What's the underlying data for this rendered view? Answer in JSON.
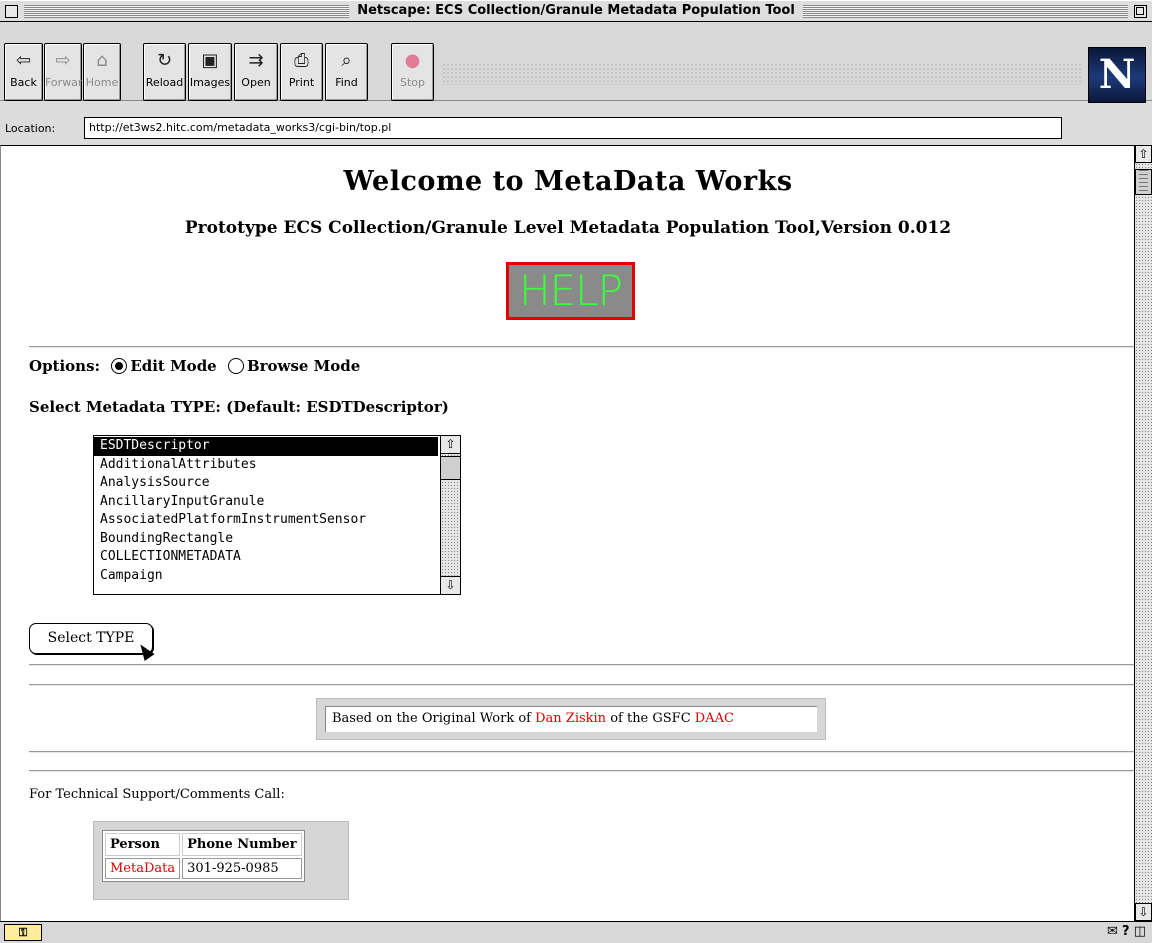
{
  "window": {
    "title": "Netscape: ECS Collection/Granule Metadata Population Tool"
  },
  "toolbar": {
    "buttons": [
      {
        "label": "Back",
        "icon": "back-arrow-icon",
        "glyph": "⇦"
      },
      {
        "label": "Forward",
        "icon": "forward-arrow-icon",
        "glyph": "⇨"
      },
      {
        "label": "Home",
        "icon": "home-icon",
        "glyph": "⌂"
      },
      {
        "label": "Reload",
        "icon": "reload-icon",
        "glyph": "↻"
      },
      {
        "label": "Images",
        "icon": "images-icon",
        "glyph": "▣"
      },
      {
        "label": "Open",
        "icon": "open-icon",
        "glyph": "⇉"
      },
      {
        "label": "Print",
        "icon": "print-icon",
        "glyph": "⎙"
      },
      {
        "label": "Find",
        "icon": "find-icon",
        "glyph": "⌕"
      },
      {
        "label": "Stop",
        "icon": "stop-icon",
        "glyph": "●"
      }
    ],
    "logo_letter": "N"
  },
  "location": {
    "label": "Location:",
    "url": "http://et3ws2.hitc.com/metadata_works3/cgi-bin/top.pl"
  },
  "page": {
    "heading": "Welcome to MetaData Works",
    "subheading": "Prototype ECS Collection/Granule Level Metadata Population Tool,Version 0.012",
    "help_label": "HELP",
    "options_label": "Options:",
    "edit_mode_label": "Edit Mode",
    "browse_mode_label": "Browse Mode",
    "select_type_label": "Select Metadata TYPE: (Default: ESDTDescriptor)",
    "type_list": [
      "ESDTDescriptor",
      "AdditionalAttributes",
      "AnalysisSource",
      "AncillaryInputGranule",
      "AssociatedPlatformInstrumentSensor",
      "BoundingRectangle",
      "COLLECTIONMETADATA",
      "Campaign"
    ],
    "selected_type": "ESDTDescriptor",
    "select_button": "Select TYPE",
    "credit_prefix": "Based on the Original Work of ",
    "credit_name": "Dan Ziskin",
    "credit_middle": " of the GSFC ",
    "credit_org": "DAAC",
    "support_text": "For Technical Support/Comments Call:",
    "contact_table": {
      "headers": [
        "Person",
        "Phone Number"
      ],
      "rows": [
        [
          "MetaData",
          "301-925-0985"
        ]
      ]
    }
  },
  "colors": {
    "help_border": "#e40000",
    "help_text": "#3cff3c",
    "link": "#e00000"
  }
}
